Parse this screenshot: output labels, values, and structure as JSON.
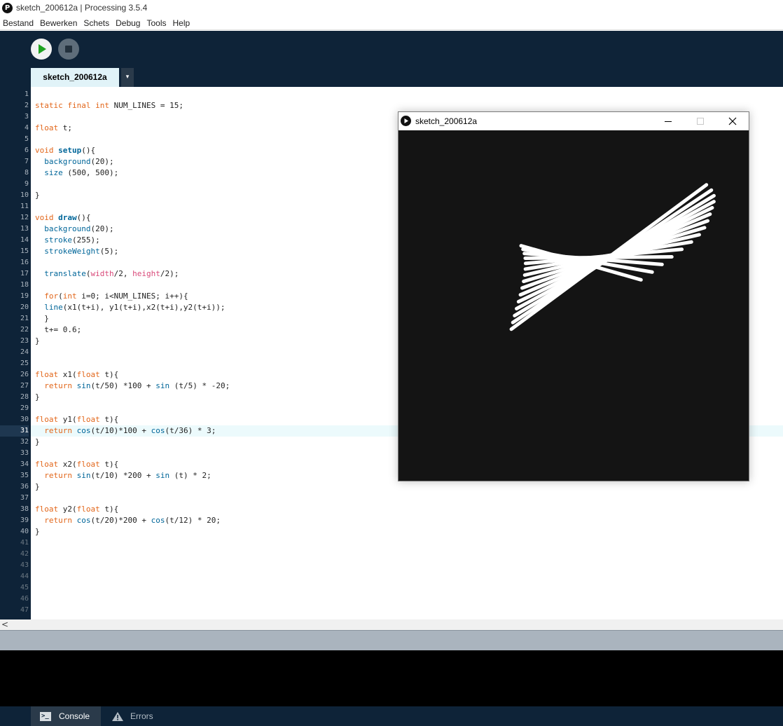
{
  "app": {
    "window_title": "sketch_200612a | Processing 3.5.4",
    "logo_glyph": "P"
  },
  "menu": [
    "Bestand",
    "Bewerken",
    "Schets",
    "Debug",
    "Tools",
    "Help"
  ],
  "toolbar": {
    "run_icon": "play-icon",
    "stop_icon": "stop-icon"
  },
  "tabs": {
    "active_tab": "sketch_200612a",
    "menu_arrow": "▾"
  },
  "editor": {
    "current_line": 31,
    "line_count": 47,
    "code_lines": [
      "",
      "static final int NUM_LINES = 15;",
      "",
      "float t;",
      "",
      "void setup(){",
      "  background(20);",
      "  size (500, 500);",
      "",
      "}",
      "",
      "void draw(){",
      "  background(20);",
      "  stroke(255);",
      "  strokeWeight(5);",
      "",
      "  translate(width/2, height/2);",
      "",
      "  for(int i=0; i<NUM_LINES; i++){",
      "  line(x1(t+i), y1(t+i),x2(t+i),y2(t+i));",
      "  }",
      "  t+= 0.6;",
      "}",
      "",
      "",
      "float x1(float t){",
      "  return sin(t/50) *100 + sin (t/5) * -20;",
      "}",
      "",
      "float y1(float t){",
      "  return cos(t/10)*100 + cos(t/36) * 3;",
      "}",
      "",
      "float x2(float t){",
      "  return sin(t/10) *200 + sin (t) * 2;",
      "}",
      "",
      "float y2(float t){",
      "  return cos(t/20)*200 + cos(t/12) * 20;",
      "}"
    ]
  },
  "scrollbar": {
    "left_arrow": "<"
  },
  "footer": {
    "console_label": "Console",
    "console_icon_glyph": ">_",
    "errors_label": "Errors"
  },
  "sketch_window": {
    "title": "sketch_200612a",
    "minimize_glyph": "—",
    "maximize_glyph": "☐",
    "close_glyph": "✕",
    "background_color": "#141414",
    "stroke_color": "#ffffff",
    "canvas_size": [
      500,
      500
    ],
    "t": 0.0,
    "num_lines": 15
  },
  "colors": {
    "toolbar_bg": "#0e2338",
    "tab_active_bg": "#e1f3f8",
    "current_line_bg": "#ecfafc",
    "keyword_orange": "#e2661a",
    "function_blue": "#006699",
    "type_green": "#33997e",
    "variable_pink": "#d94a7a",
    "console_bg": "#000000"
  }
}
